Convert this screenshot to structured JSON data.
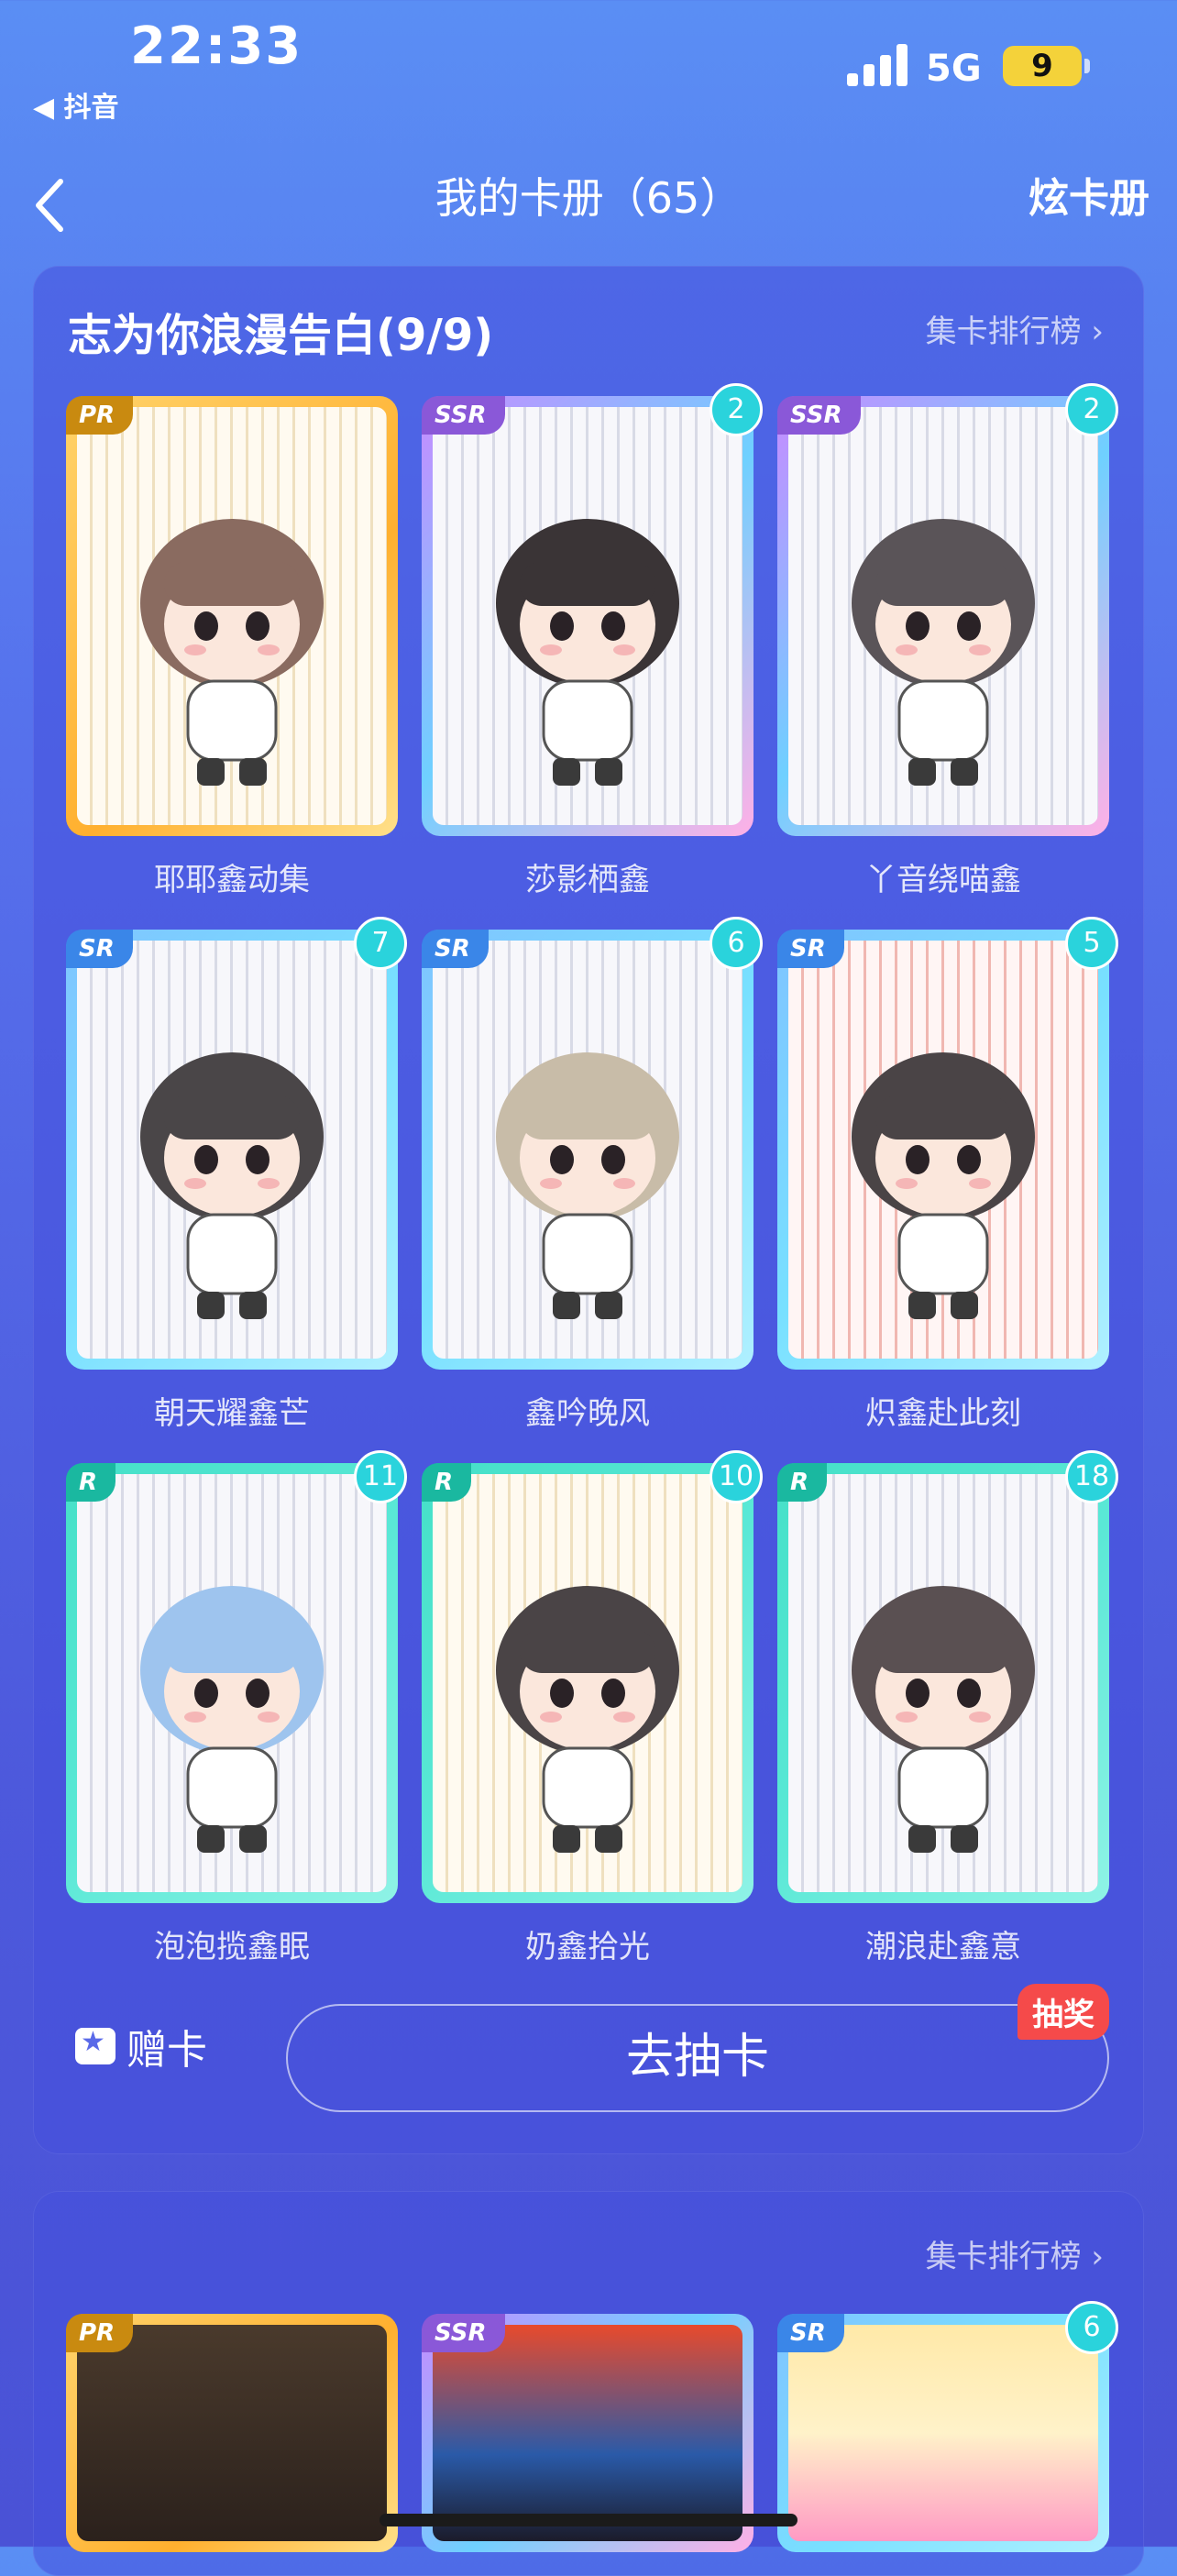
{
  "status_bar": {
    "time": "22:33",
    "back_app": "◀ 抖音",
    "network": "5G",
    "battery": "9"
  },
  "nav": {
    "title": "我的卡册（65）",
    "right_action": "炫卡册"
  },
  "album": {
    "title": "志为你浪漫告白(9/9)",
    "rank_link": "集卡排行榜 ›",
    "cards": [
      {
        "name": "耶耶鑫动集",
        "rarity": "PR",
        "count": ""
      },
      {
        "name": "莎影栖鑫",
        "rarity": "SSR",
        "count": "2"
      },
      {
        "name": "丫音绕喵鑫",
        "rarity": "SSR",
        "count": "2"
      },
      {
        "name": "朝天耀鑫芒",
        "rarity": "SR",
        "count": "7"
      },
      {
        "name": "鑫吟晚风",
        "rarity": "SR",
        "count": "6"
      },
      {
        "name": "炽鑫赴此刻",
        "rarity": "SR",
        "count": "5"
      },
      {
        "name": "泡泡揽鑫眠",
        "rarity": "R",
        "count": "11"
      },
      {
        "name": "奶鑫拾光",
        "rarity": "R",
        "count": "10"
      },
      {
        "name": "潮浪赴鑫意",
        "rarity": "R",
        "count": "18"
      }
    ],
    "gift_label": "赠卡",
    "draw_label": "去抽卡",
    "lottery_badge": "抽奖"
  },
  "album2": {
    "rank_link": "集卡排行榜 ›",
    "cards": [
      {
        "rarity": "PR",
        "count": ""
      },
      {
        "rarity": "SSR",
        "count": ""
      },
      {
        "rarity": "SR",
        "count": "6"
      }
    ]
  }
}
